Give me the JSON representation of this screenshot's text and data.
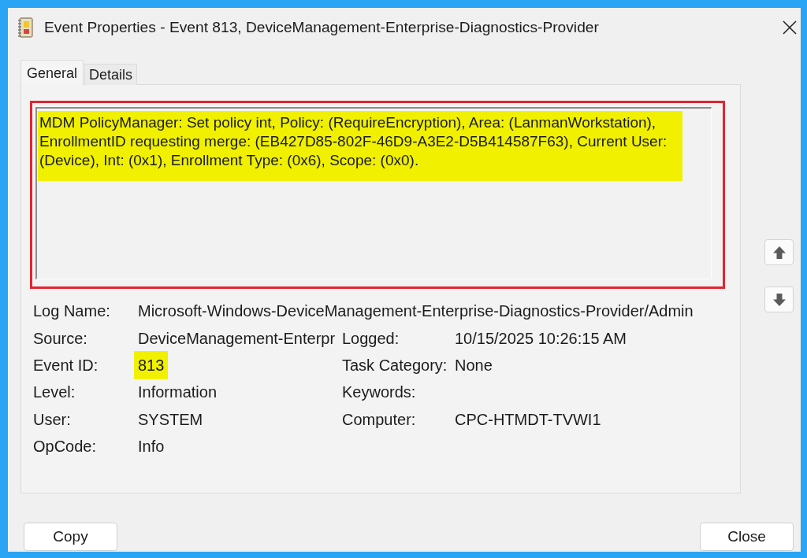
{
  "window": {
    "title": "Event Properties - Event 813, DeviceManagement-Enterprise-Diagnostics-Provider"
  },
  "tabs": [
    {
      "label": "General",
      "selected": true
    },
    {
      "label": "Details",
      "selected": false
    }
  ],
  "description": {
    "text": "MDM PolicyManager: Set policy int, Policy: (RequireEncryption), Area: (LanmanWorkstation), EnrollmentID requesting merge: (EB427D85-802F-46D9-A3E2-D5B414587F63), Current User: (Device), Int: (0x1), Enrollment Type: (0x6), Scope: (0x0).",
    "highlighted": true,
    "outlined": true
  },
  "field_rows": [
    [
      {
        "label": "Log Name:",
        "value": "Microsoft-Windows-DeviceManagement-Enterprise-Diagnostics-Provider/Admin"
      }
    ],
    [
      {
        "label": "Source:",
        "value": "DeviceManagement-Enterpr"
      },
      {
        "label": "Logged:",
        "value": "10/15/2025 10:26:15 AM"
      }
    ],
    [
      {
        "label": "Event ID:",
        "value": "813",
        "highlighted": true
      },
      {
        "label": "Task Category:",
        "value": "None"
      }
    ],
    [
      {
        "label": "Level:",
        "value": "Information"
      },
      {
        "label": "Keywords:"
      }
    ],
    [
      {
        "label": "User:",
        "value": "SYSTEM"
      },
      {
        "label": "Computer:",
        "value": "CPC-HTMDT-TVWI1"
      }
    ],
    [
      {
        "label": "OpCode:",
        "value": "Info"
      }
    ]
  ],
  "buttons": [
    "Copy",
    "Close"
  ]
}
